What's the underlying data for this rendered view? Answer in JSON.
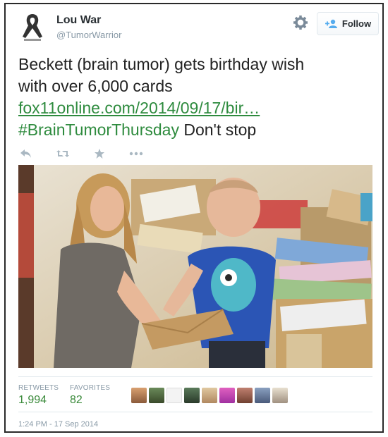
{
  "user": {
    "name": "Lou War",
    "handle": "@TumorWarrior"
  },
  "follow": {
    "label": "Follow"
  },
  "tweet": {
    "text_line1": "Beckett (brain tumor) gets birthday wish",
    "text_line2": "with over 6,000 cards",
    "link": "fox11online.com/2014/09/17/bir…",
    "hashtag": "#BrainTumorThursday",
    "tail": " Don't stop"
  },
  "stats": {
    "retweets_label": "RETWEETS",
    "retweets_value": "1,994",
    "favorites_label": "FAVORITES",
    "favorites_value": "82"
  },
  "timestamp": "1:24 PM - 17 Sep 2014",
  "colors": {
    "link_green": "#2e8b3e",
    "muted": "#8899a6",
    "count_green": "#3a8a3a"
  },
  "icons": [
    "ribbon-avatar",
    "gear-icon",
    "follow-add-user-icon",
    "reply-icon",
    "retweet-icon",
    "favorite-icon",
    "more-icon"
  ]
}
